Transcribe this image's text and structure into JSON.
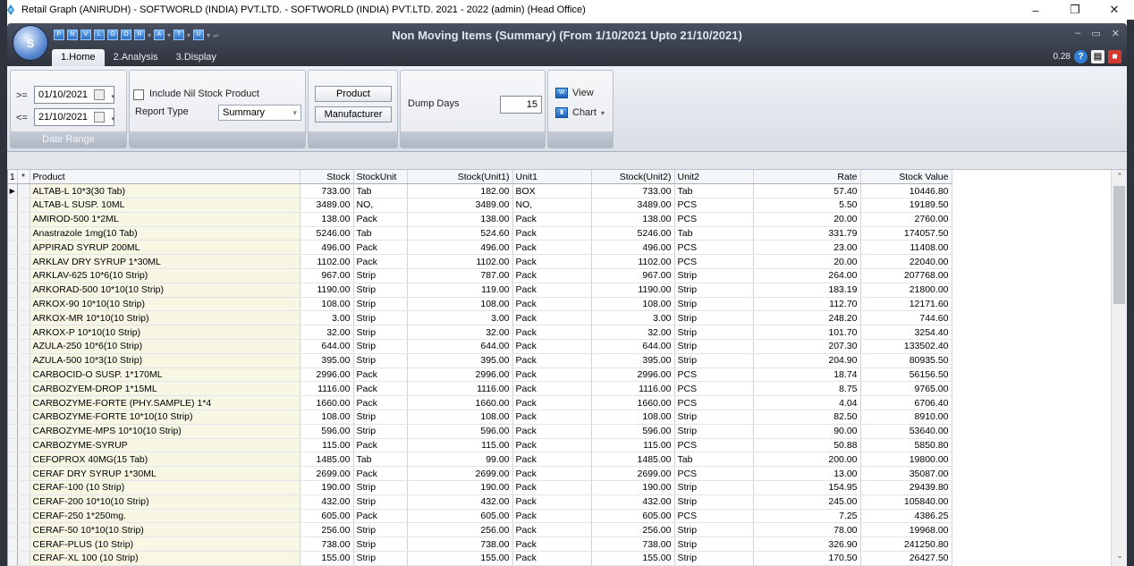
{
  "os_window": {
    "title": "Retail Graph (ANIRUDH) - SOFTWORLD (INDIA) PVT.LTD. - SOFTWORLD (INDIA) PVT.LTD.  2021 - 2022 (admin) (Head Office)",
    "minimize": "–",
    "maximize": "❐",
    "close": "✕"
  },
  "app": {
    "title": "Non Moving Items (Summary)  (From 1/10/2021 Upto 21/10/2021)",
    "orb_label": "S",
    "tabs": [
      "1.Home",
      "2.Analysis",
      "3.Display"
    ],
    "version": "0.28",
    "help_icon": "?",
    "head_ctl": [
      "–",
      "▭",
      "✕"
    ]
  },
  "ribbon": {
    "date_range": {
      "from_op": ">=",
      "from": "01/10/2021",
      "to_op": "<=",
      "to": "21/10/2021",
      "group_label": "Date Range"
    },
    "options": {
      "include_nil_label": "Include Nil Stock Product",
      "report_type_label": "Report Type",
      "report_type_value": "Summary"
    },
    "buttons": {
      "product": "Product",
      "manufacturer": "Manufacturer"
    },
    "dump": {
      "label": "Dump Days",
      "value": "15"
    },
    "actions": {
      "view": "View",
      "chart": "Chart"
    }
  },
  "grid": {
    "headers": [
      "1",
      "*",
      "Product",
      "Stock",
      "StockUnit",
      "Stock(Unit1)",
      "Unit1",
      "Stock(Unit2)",
      "Unit2",
      "Rate",
      "Stock Value"
    ],
    "rows": [
      [
        "ALTAB-L 10*3(30 Tab)",
        "733.00",
        "Tab",
        "182.00",
        "BOX",
        "733.00",
        "Tab",
        "57.40",
        "10446.80"
      ],
      [
        "ALTAB-L SUSP. 10ML",
        "3489.00",
        "NO,",
        "3489.00",
        "NO,",
        "3489.00",
        "PCS",
        "5.50",
        "19189.50"
      ],
      [
        "AMIROD-500 1*2ML",
        "138.00",
        "Pack",
        "138.00",
        "Pack",
        "138.00",
        "PCS",
        "20.00",
        "2760.00"
      ],
      [
        "Anastrazole 1mg(10 Tab)",
        "5246.00",
        "Tab",
        "524.60",
        "Pack",
        "5246.00",
        "Tab",
        "331.79",
        "174057.50"
      ],
      [
        "APPIRAD SYRUP 200ML",
        "496.00",
        "Pack",
        "496.00",
        "Pack",
        "496.00",
        "PCS",
        "23.00",
        "11408.00"
      ],
      [
        "ARKLAV DRY SYRUP 1*30ML",
        "1102.00",
        "Pack",
        "1102.00",
        "Pack",
        "1102.00",
        "PCS",
        "20.00",
        "22040.00"
      ],
      [
        "ARKLAV-625 10*6(10 Strip)",
        "967.00",
        "Strip",
        "787.00",
        "Pack",
        "967.00",
        "Strip",
        "264.00",
        "207768.00"
      ],
      [
        "ARKORAD-500 10*10(10 Strip)",
        "1190.00",
        "Strip",
        "119.00",
        "Pack",
        "1190.00",
        "Strip",
        "183.19",
        "21800.00"
      ],
      [
        "ARKOX-90 10*10(10 Strip)",
        "108.00",
        "Strip",
        "108.00",
        "Pack",
        "108.00",
        "Strip",
        "112.70",
        "12171.60"
      ],
      [
        "ARKOX-MR 10*10(10 Strip)",
        "3.00",
        "Strip",
        "3.00",
        "Pack",
        "3.00",
        "Strip",
        "248.20",
        "744.60"
      ],
      [
        "ARKOX-P 10*10(10 Strip)",
        "32.00",
        "Strip",
        "32.00",
        "Pack",
        "32.00",
        "Strip",
        "101.70",
        "3254.40"
      ],
      [
        "AZULA-250 10*6(10 Strip)",
        "644.00",
        "Strip",
        "644.00",
        "Pack",
        "644.00",
        "Strip",
        "207.30",
        "133502.40"
      ],
      [
        "AZULA-500 10*3(10 Strip)",
        "395.00",
        "Strip",
        "395.00",
        "Pack",
        "395.00",
        "Strip",
        "204.90",
        "80935.50"
      ],
      [
        "CARBOCID-O SUSP. 1*170ML",
        "2996.00",
        "Pack",
        "2996.00",
        "Pack",
        "2996.00",
        "PCS",
        "18.74",
        "56156.50"
      ],
      [
        "CARBOZYEM-DROP 1*15ML",
        "1116.00",
        "Pack",
        "1116.00",
        "Pack",
        "1116.00",
        "PCS",
        "8.75",
        "9765.00"
      ],
      [
        "CARBOZYME-FORTE (PHY.SAMPLE) 1*4",
        "1660.00",
        "Pack",
        "1660.00",
        "Pack",
        "1660.00",
        "PCS",
        "4.04",
        "6706.40"
      ],
      [
        "CARBOZYME-FORTE 10*10(10 Strip)",
        "108.00",
        "Strip",
        "108.00",
        "Pack",
        "108.00",
        "Strip",
        "82.50",
        "8910.00"
      ],
      [
        "CARBOZYME-MPS 10*10(10 Strip)",
        "596.00",
        "Strip",
        "596.00",
        "Pack",
        "596.00",
        "Strip",
        "90.00",
        "53640.00"
      ],
      [
        "CARBOZYME-SYRUP",
        "115.00",
        "Pack",
        "115.00",
        "Pack",
        "115.00",
        "PCS",
        "50.88",
        "5850.80"
      ],
      [
        "CEFOPROX 40MG(15 Tab)",
        "1485.00",
        "Tab",
        "99.00",
        "Pack",
        "1485.00",
        "Tab",
        "200.00",
        "19800.00"
      ],
      [
        "CERAF DRY SYRUP 1*30ML",
        "2699.00",
        "Pack",
        "2699.00",
        "Pack",
        "2699.00",
        "PCS",
        "13.00",
        "35087.00"
      ],
      [
        "CERAF-100 (10 Strip)",
        "190.00",
        "Strip",
        "190.00",
        "Pack",
        "190.00",
        "Strip",
        "154.95",
        "29439.80"
      ],
      [
        "CERAF-200 10*10(10 Strip)",
        "432.00",
        "Strip",
        "432.00",
        "Pack",
        "432.00",
        "Strip",
        "245.00",
        "105840.00"
      ],
      [
        "CERAF-250 1*250mg.",
        "605.00",
        "Pack",
        "605.00",
        "Pack",
        "605.00",
        "PCS",
        "7.25",
        "4386.25"
      ],
      [
        "CERAF-50 10*10(10 Strip)",
        "256.00",
        "Strip",
        "256.00",
        "Pack",
        "256.00",
        "Strip",
        "78.00",
        "19968.00"
      ],
      [
        "CERAF-PLUS (10 Strip)",
        "738.00",
        "Strip",
        "738.00",
        "Pack",
        "738.00",
        "Strip",
        "326.90",
        "241250.80"
      ],
      [
        "CERAF-XL 100 (10 Strip)",
        "155.00",
        "Strip",
        "155.00",
        "Pack",
        "155.00",
        "Strip",
        "170.50",
        "26427.50"
      ]
    ]
  }
}
